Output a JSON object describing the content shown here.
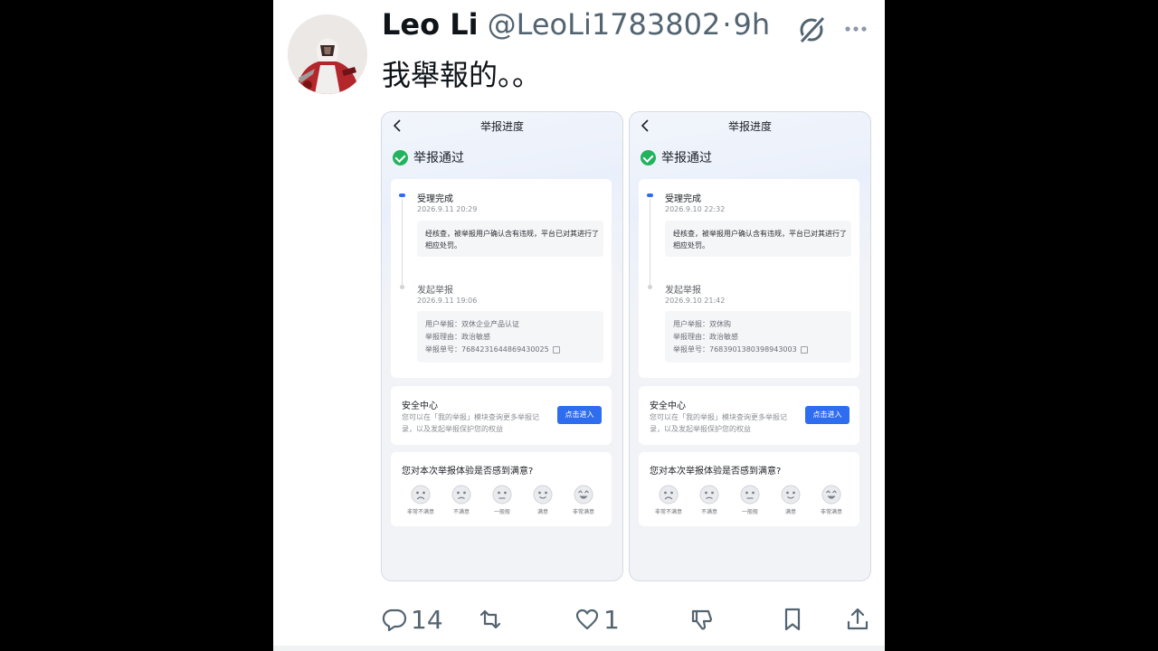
{
  "tweet": {
    "display_name": "Leo Li",
    "handle": "@LeoLi1783802",
    "separator": "·",
    "time": "9h",
    "text": "我舉報的。。"
  },
  "screens": [
    {
      "title": "举报进度",
      "status": "举报通过",
      "step1_title": "受理完成",
      "step1_time": "2026.9.11 20:29",
      "step1_detail": "经核查，被举报用户确认含有违规，平台已对其进行了相应处罚。",
      "step2_title": "发起举报",
      "step2_time": "2026.9.11 19:06",
      "reported_user": "用户举报：双休企业产品认证",
      "reason": "举报理由：政治敏感",
      "report_no": "举报单号：7684231644869430025",
      "security_title": "安全中心",
      "security_desc": "您可以在「我的举报」模块查询更多举报记录，以及发起举报保护您的权益",
      "enter_button": "点击进入",
      "survey_question": "您对本次举报体验是否感到满意?",
      "ratings": [
        "非常不满意",
        "不满意",
        "一般般",
        "满意",
        "非常满意"
      ]
    },
    {
      "title": "举报进度",
      "status": "举报通过",
      "step1_title": "受理完成",
      "step1_time": "2026.9.10 22:32",
      "step1_detail": "经核查，被举报用户确认含有违规，平台已对其进行了相应处罚。",
      "step2_title": "发起举报",
      "step2_time": "2026.9.10 21:42",
      "reported_user": "用户举报：双休购",
      "reason": "举报理由：政治敏感",
      "report_no": "举报单号：7683901380398943003",
      "security_title": "安全中心",
      "security_desc": "您可以在「我的举报」模块查询更多举报记录，以及发起举报保护您的权益",
      "enter_button": "点击进入",
      "survey_question": "您对本次举报体验是否感到满意?",
      "ratings": [
        "非常不满意",
        "不满意",
        "一般般",
        "满意",
        "非常满意"
      ]
    }
  ],
  "actions": {
    "replies": "14",
    "reposts": "",
    "likes": "1"
  },
  "colors": {
    "accent_blue": "#2f6df0",
    "success_green": "#22b35e",
    "text_secondary": "#536471"
  }
}
